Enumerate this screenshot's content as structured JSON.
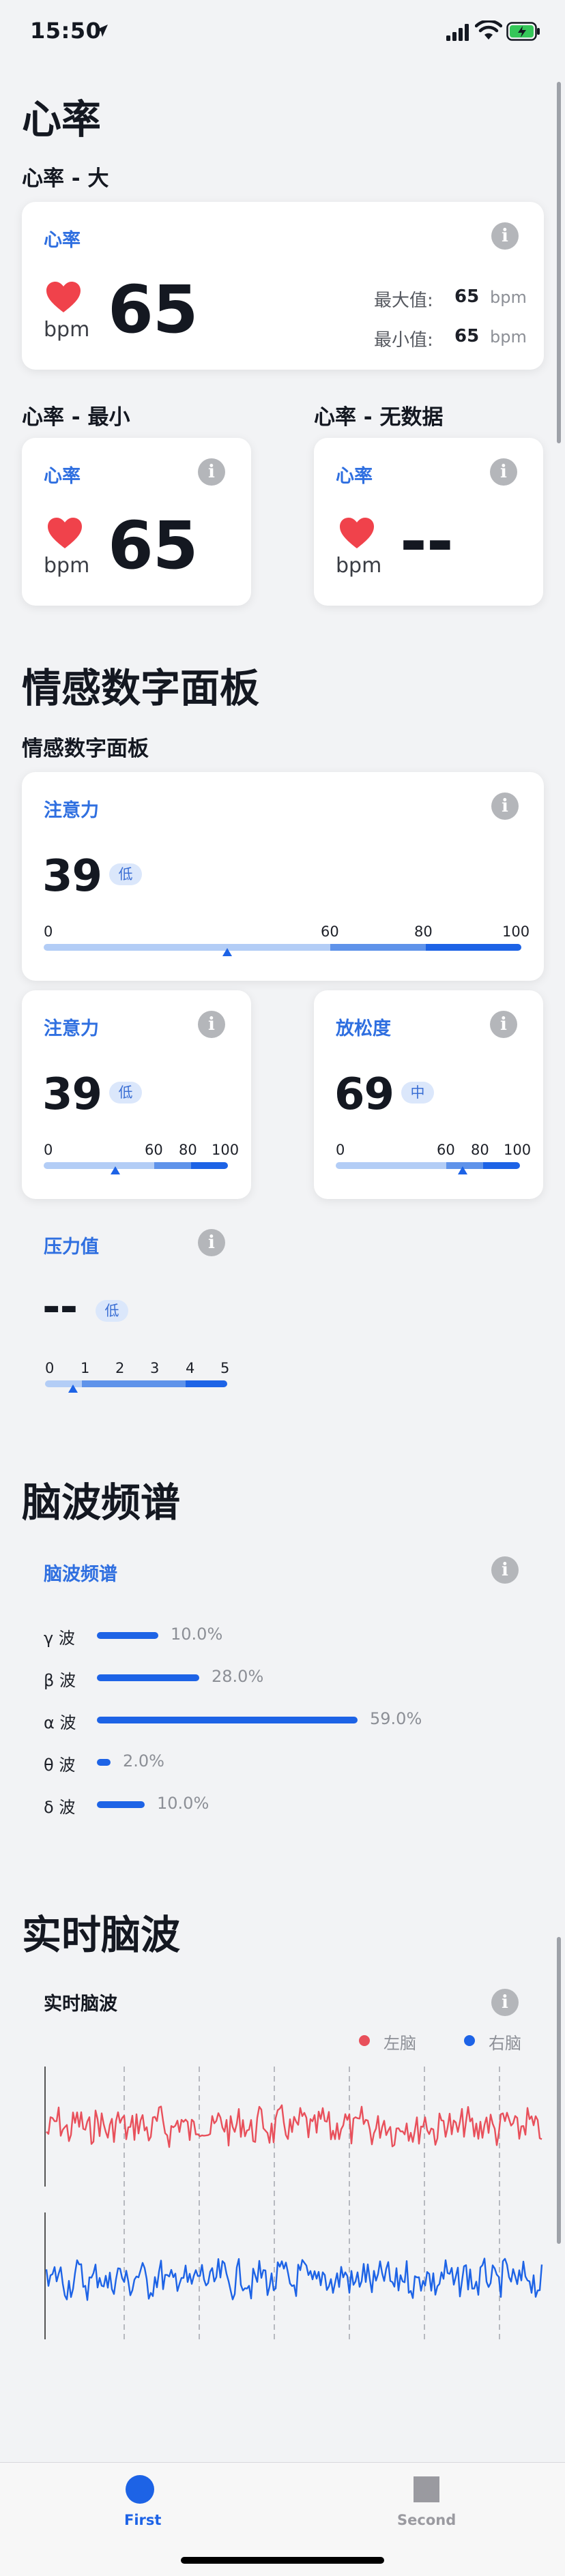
{
  "status_bar": {
    "time": "15:50"
  },
  "heart_rate_section": {
    "title": "心率",
    "large": {
      "subtitle": "心率 - 大",
      "card_title": "心率",
      "unit": "bpm",
      "value": "65",
      "max_label": "最大值:",
      "max_value": "65",
      "min_label": "最小值:",
      "min_value": "65",
      "max_unit": "bpm",
      "min_unit": "bpm"
    },
    "small": {
      "subtitle": "心率 - 最小",
      "card_title": "心率",
      "unit": "bpm",
      "value": "65"
    },
    "empty": {
      "subtitle": "心率 - 无数据",
      "card_title": "心率",
      "unit": "bpm",
      "value": "--"
    }
  },
  "emotion_section": {
    "title": "情感数字面板",
    "subtitle": "情感数字面板",
    "attention_large": {
      "card_title": "注意力",
      "value": "39",
      "level": "低",
      "scale": [
        "0",
        "60",
        "80",
        "100"
      ],
      "level_value": 39
    },
    "attention_small": {
      "card_title": "注意力",
      "value": "39",
      "level": "低",
      "scale": [
        "0",
        "60",
        "80",
        "100"
      ],
      "level_value": 39
    },
    "relaxation": {
      "card_title": "放松度",
      "value": "69",
      "level": "中",
      "scale": [
        "0",
        "60",
        "80",
        "100"
      ],
      "level_value": 69
    },
    "pressure": {
      "card_title": "压力值",
      "value": "--",
      "level": "低",
      "scale": [
        "0",
        "1",
        "2",
        "3",
        "4",
        "5"
      ],
      "level_value": 0.8
    }
  },
  "brainwave_spectrum_section": {
    "title": "脑波频谱",
    "card_title": "脑波频谱",
    "bands": [
      {
        "label": "γ 波",
        "percent": 10.0,
        "text": "10.0%"
      },
      {
        "label": "β 波",
        "percent": 28.0,
        "text": "28.0%"
      },
      {
        "label": "α 波",
        "percent": 59.0,
        "text": "59.0%"
      },
      {
        "label": "θ 波",
        "percent": 2.0,
        "text": "2.0%"
      },
      {
        "label": "δ 波",
        "percent": 10.0,
        "text": "10.0%"
      }
    ]
  },
  "realtime_section": {
    "title": "实时脑波",
    "card_title": "实时脑波",
    "legend_left": "左脑",
    "legend_right": "右脑",
    "colors": {
      "left": "#e8505b",
      "right": "#1d63e6"
    }
  },
  "tabbar": {
    "first_label": "First",
    "second_label": "Second",
    "active_color": "#1d63e6",
    "inactive_color": "#9a9aa0"
  },
  "colors": {
    "accent": "#2f6fe0",
    "heart": "#f0424b"
  }
}
